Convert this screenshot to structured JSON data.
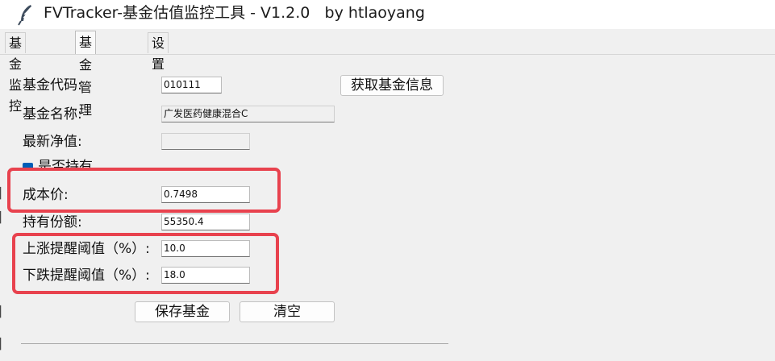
{
  "window": {
    "title": "FVTracker-基金估值监控工具 - V1.2.0   by htlaoyang"
  },
  "tabs": [
    {
      "label": "基金监控",
      "active": false
    },
    {
      "label": "基金管理",
      "active": true
    },
    {
      "label": "设置",
      "active": false
    }
  ],
  "form": {
    "code_label": "基金代码:",
    "code_value": "010111",
    "fetch_button": "获取基金信息",
    "name_label": "基金名称:",
    "name_value": "广发医药健康混合C",
    "nav_label": "最新净值:",
    "nav_value": "",
    "holding_label": "是否持有",
    "holding_checked": true,
    "cost_label": "成本价:",
    "cost_value": "0.7498",
    "shares_label": "持有份额:",
    "shares_value": "55350.4",
    "rise_label": "上涨提醒阈值（%）:",
    "rise_value": "10.0",
    "fall_label": "下跌提醒阈值（%）:",
    "fall_value": "18.0",
    "save_button": "保存基金",
    "clear_button": "清空"
  },
  "colors": {
    "highlight": "#e8424e",
    "checkbox": "#005fb8"
  },
  "icons": {
    "app": "feather-icon"
  }
}
